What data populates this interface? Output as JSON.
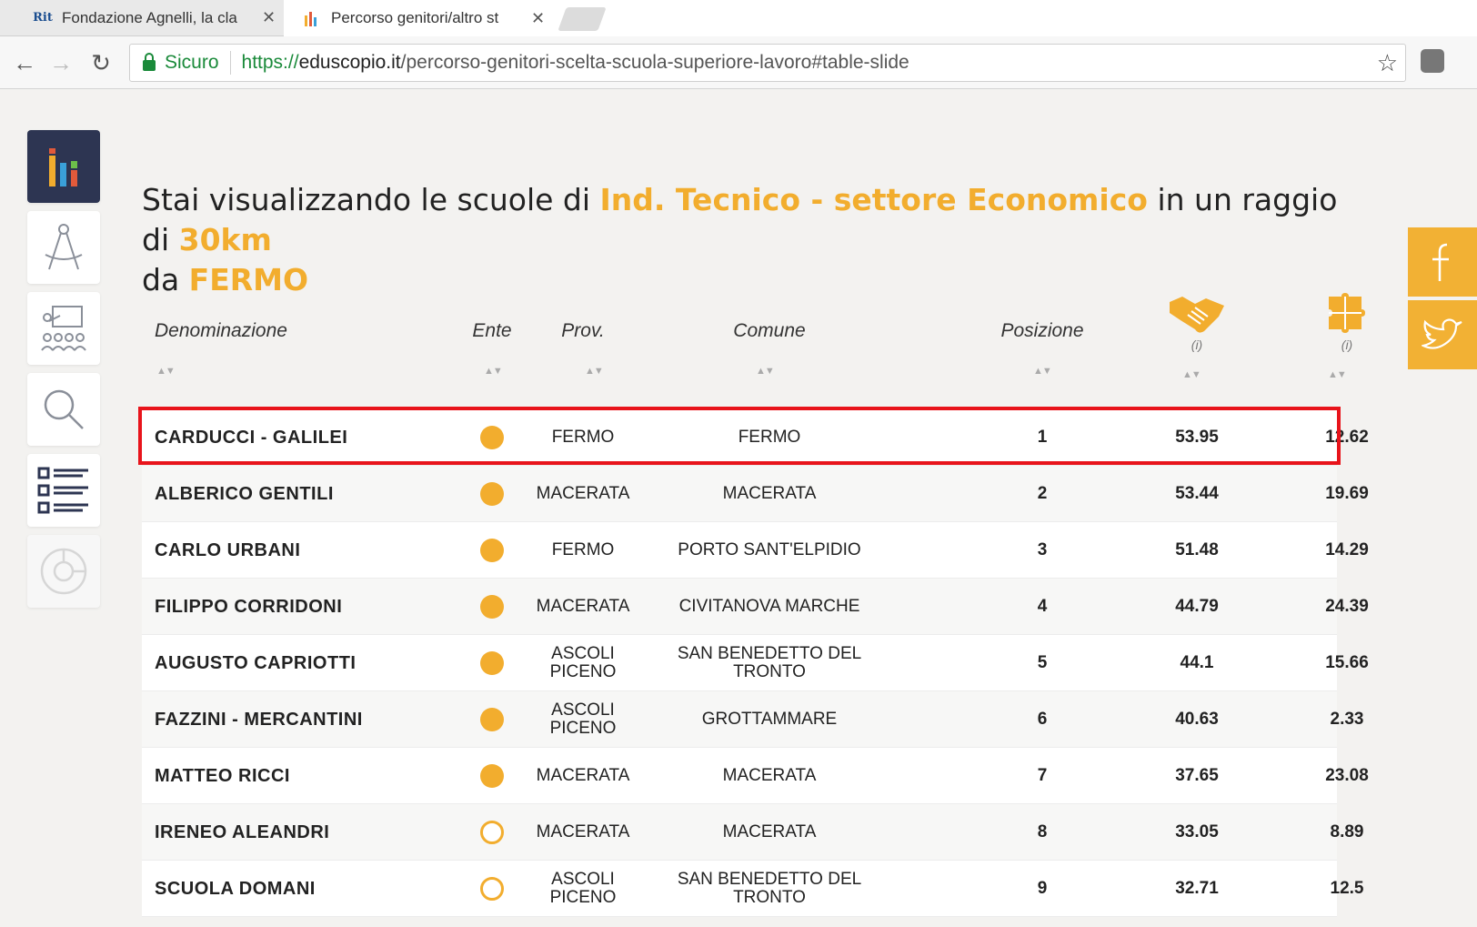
{
  "browser": {
    "tabs": [
      {
        "title": "Fondazione Agnelli, la cla",
        "favicon": "Rit"
      },
      {
        "title": "Percorso genitori/altro st",
        "favicon": "bar-chart"
      }
    ],
    "secure_label": "Sicuro",
    "url_scheme": "https://",
    "url_host": "eduscopio.it",
    "url_path": "/percorso-genitori-scelta-scuola-superiore-lavoro#table-slide"
  },
  "heading": {
    "part1": "Stai visualizzando le scuole di ",
    "school_type": "Ind. Tecnico - settore Economico",
    "part2": " in un raggio di ",
    "radius": "30km",
    "part3": "da ",
    "city": "FERMO"
  },
  "columns": {
    "denominazione": "Denominazione",
    "ente": "Ente",
    "prov": "Prov.",
    "comune": "Comune",
    "posizione": "Posizione",
    "info1": "(i)",
    "info2": "(i)"
  },
  "rows": [
    {
      "name": "CARDUCCI - GALILEI",
      "ente": "filled",
      "prov": "FERMO",
      "comune": "FERMO",
      "pos": "1",
      "v1": "53.95",
      "v2": "12.62"
    },
    {
      "name": "ALBERICO GENTILI",
      "ente": "filled",
      "prov": "MACERATA",
      "comune": "MACERATA",
      "pos": "2",
      "v1": "53.44",
      "v2": "19.69"
    },
    {
      "name": "CARLO URBANI",
      "ente": "filled",
      "prov": "FERMO",
      "comune": "PORTO SANT'ELPIDIO",
      "pos": "3",
      "v1": "51.48",
      "v2": "14.29"
    },
    {
      "name": "FILIPPO CORRIDONI",
      "ente": "filled",
      "prov": "MACERATA",
      "comune": "CIVITANOVA MARCHE",
      "pos": "4",
      "v1": "44.79",
      "v2": "24.39"
    },
    {
      "name": "AUGUSTO CAPRIOTTI",
      "ente": "filled",
      "prov": "ASCOLI PICENO",
      "comune": "SAN BENEDETTO DEL TRONTO",
      "pos": "5",
      "v1": "44.1",
      "v2": "15.66"
    },
    {
      "name": "FAZZINI - MERCANTINI",
      "ente": "filled",
      "prov": "ASCOLI PICENO",
      "comune": "GROTTAMMARE",
      "pos": "6",
      "v1": "40.63",
      "v2": "2.33"
    },
    {
      "name": "MATTEO RICCI",
      "ente": "filled",
      "prov": "MACERATA",
      "comune": "MACERATA",
      "pos": "7",
      "v1": "37.65",
      "v2": "23.08"
    },
    {
      "name": "IRENEO ALEANDRI",
      "ente": "open",
      "prov": "MACERATA",
      "comune": "MACERATA",
      "pos": "8",
      "v1": "33.05",
      "v2": "8.89"
    },
    {
      "name": "SCUOLA DOMANI",
      "ente": "open",
      "prov": "ASCOLI PICENO",
      "comune": "SAN BENEDETTO DEL TRONTO",
      "pos": "9",
      "v1": "32.71",
      "v2": "12.5"
    }
  ],
  "colors": {
    "accent": "#f2ad2e",
    "highlight": "#e8141b",
    "sidebar_active": "#2d3552"
  }
}
